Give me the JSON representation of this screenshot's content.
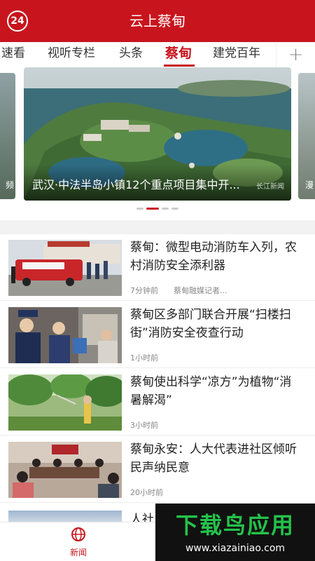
{
  "header": {
    "badge": "24",
    "title": "云上蔡甸"
  },
  "tabs": [
    {
      "label": "速看"
    },
    {
      "label": "视听专栏"
    },
    {
      "label": "头条"
    },
    {
      "label": "蔡甸",
      "active": true
    },
    {
      "label": "建党百年"
    }
  ],
  "tab_add_icon": "plus-icon",
  "carousel": {
    "left_caption": "频",
    "right_caption": "漫",
    "caption": "武汉·中法半岛小镇12个重点项目集中开...",
    "watermark": "长江新闻",
    "dot_count": 4,
    "active_dot": 2
  },
  "news": [
    {
      "headline": "蔡甸：微型电动消防车入列，农村消防安全添利器",
      "time": "7分钟前",
      "source": "蔡甸融媒记者..."
    },
    {
      "headline": "蔡甸区多部门联合开展“扫楼扫街”消防安全夜查行动",
      "time": "1小时前",
      "source": ""
    },
    {
      "headline": "蔡甸使出科学“凉方”为植物“消暑解渴”",
      "time": "3小时前",
      "source": ""
    },
    {
      "headline": "蔡甸永安：人大代表进社区倾听民声纳民意",
      "time": "20小时前",
      "source": ""
    }
  ],
  "partial_item": {
    "headline": "人社"
  },
  "bottom_nav": {
    "label": "新闻",
    "icon": "globe-icon"
  },
  "ad": {
    "brand": "下载鸟应用",
    "url": "www.xiazainiao.com"
  },
  "colors": {
    "brand": "#c8151d",
    "ad_green": "#24c24a"
  }
}
